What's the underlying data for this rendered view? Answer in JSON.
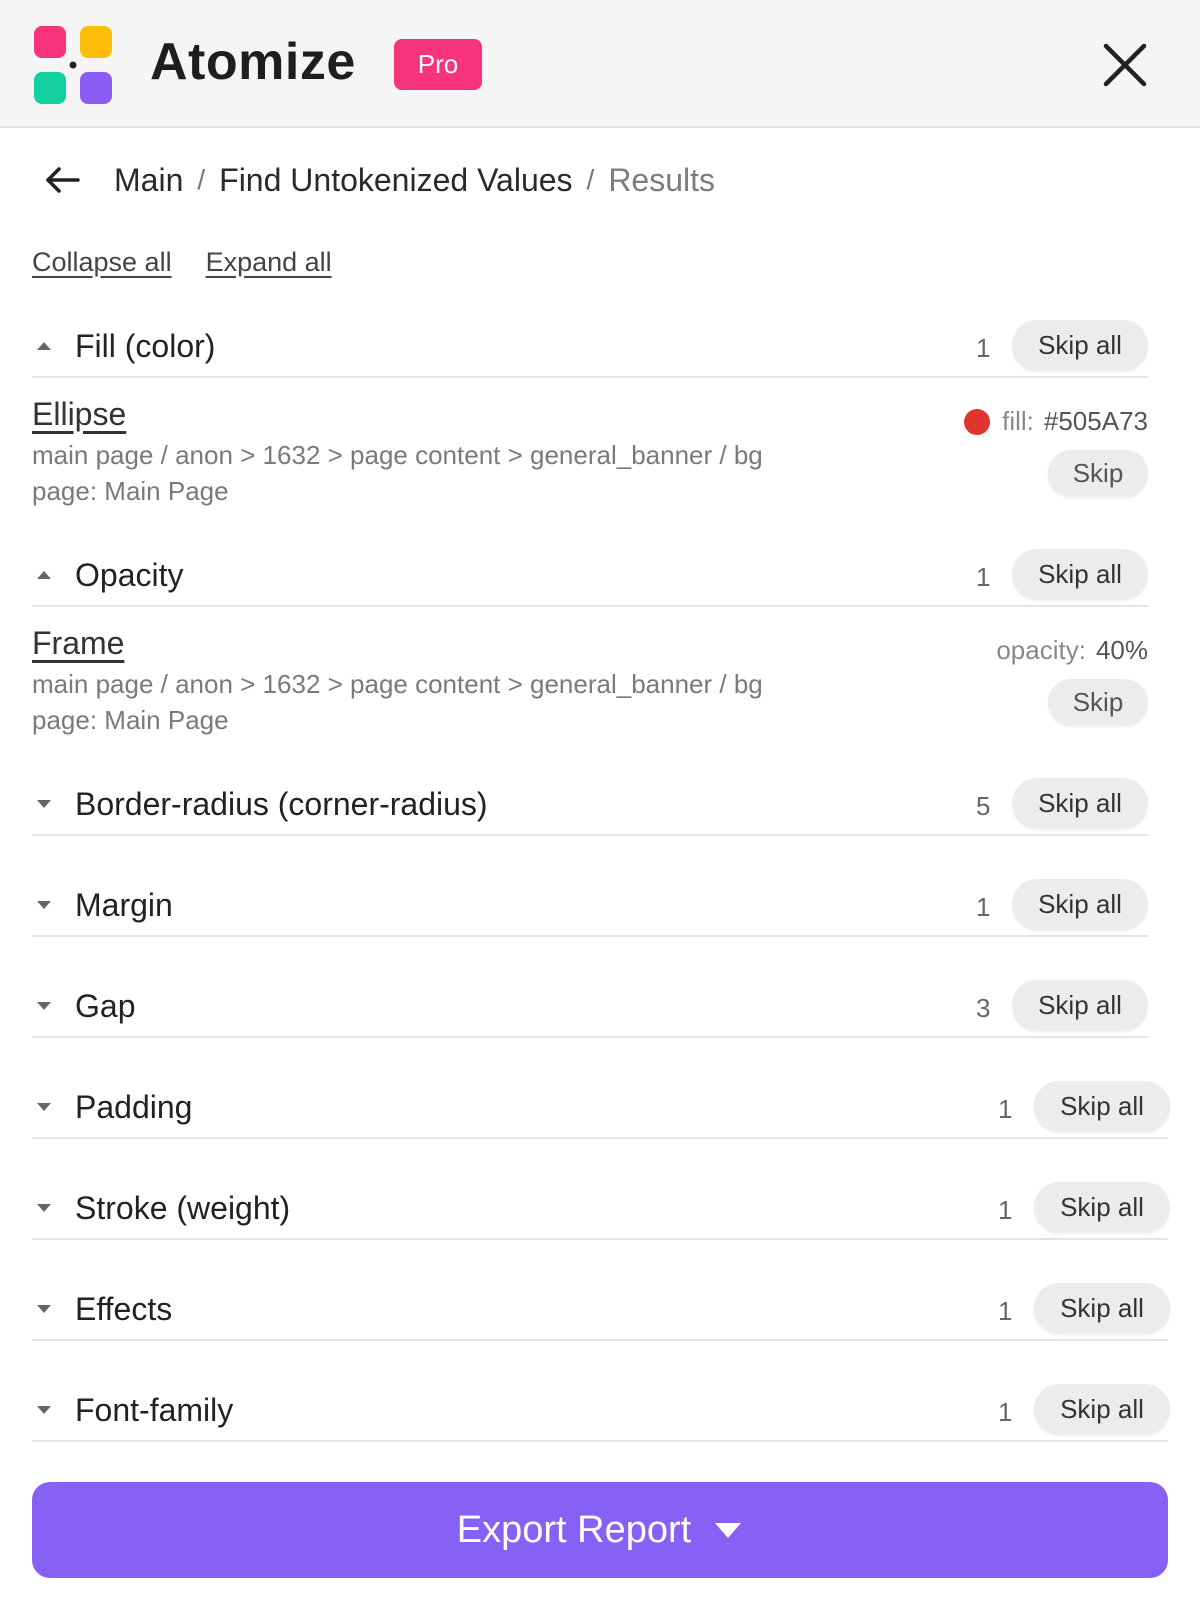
{
  "header": {
    "app_title": "Atomize",
    "badge": "Pro",
    "logo_colors": [
      "#f7337c",
      "#fbbd0a",
      "#14d0a0",
      "#8a5cf6"
    ]
  },
  "breadcrumb": {
    "items": [
      "Main",
      "Find Untokenized Values"
    ],
    "current": "Results",
    "separator": "/"
  },
  "controls": {
    "collapse_all": "Collapse all",
    "expand_all": "Expand all"
  },
  "sections": [
    {
      "title": "Fill (color)",
      "count": "1",
      "skip_label": "Skip all",
      "expanded": true
    },
    {
      "title": "Opacity",
      "count": "1",
      "skip_label": "Skip all",
      "expanded": true
    },
    {
      "title": "Border-radius (corner-radius)",
      "count": "5",
      "skip_label": "Skip all",
      "expanded": false
    },
    {
      "title": "Margin",
      "count": "1",
      "skip_label": "Skip all",
      "expanded": false
    },
    {
      "title": "Gap",
      "count": "3",
      "skip_label": "Skip all",
      "expanded": false
    },
    {
      "title": "Padding",
      "count": "1",
      "skip_label": "Skip all",
      "expanded": false
    },
    {
      "title": "Stroke (weight)",
      "count": "1",
      "skip_label": "Skip all",
      "expanded": false
    },
    {
      "title": "Effects",
      "count": "1",
      "skip_label": "Skip all",
      "expanded": false
    },
    {
      "title": "Font-family",
      "count": "1",
      "skip_label": "Skip all",
      "expanded": false
    }
  ],
  "items": [
    {
      "title": "Ellipse",
      "path": "main page / anon > 1632 > page content > general_banner / bg",
      "page": "page: Main Page",
      "value_label": "fill:",
      "value": "#505A73",
      "swatch_color": "#e0342f",
      "skip_label": "Skip"
    },
    {
      "title": "Frame",
      "path": "main page / anon > 1632 > page content > general_banner / bg",
      "page": "page: Main Page",
      "value_label": "opacity:",
      "value": "40%",
      "skip_label": "Skip"
    }
  ],
  "footer": {
    "export_label": "Export Report",
    "accent_color": "#8760f6"
  }
}
